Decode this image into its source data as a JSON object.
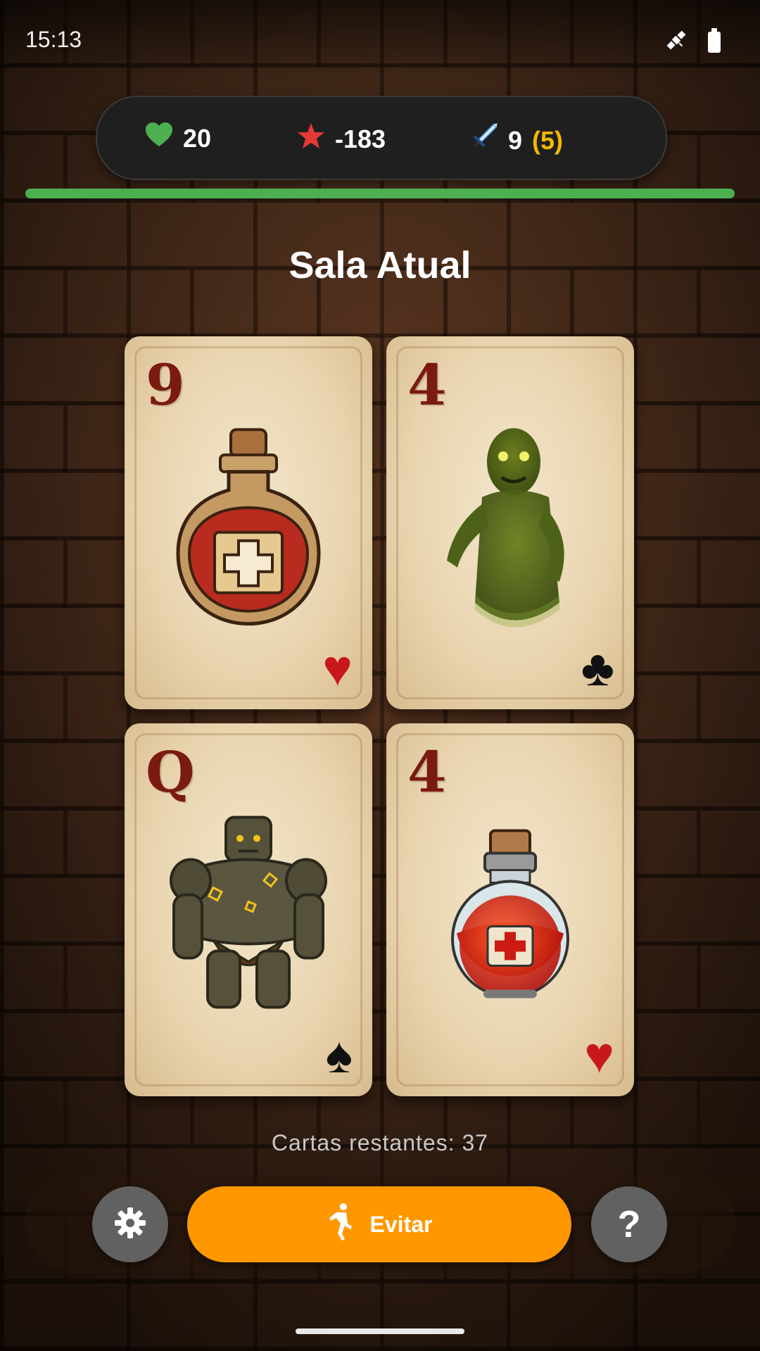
{
  "status_bar": {
    "time": "15:13",
    "icons": [
      "satellite-icon",
      "battery-icon"
    ]
  },
  "stats": {
    "health": "20",
    "score": "-183",
    "weapon_value": "9",
    "weapon_extra": "(5)",
    "icons": [
      "heart-icon",
      "star-icon",
      "sword-icon"
    ]
  },
  "health_progress": 1.0,
  "room_title": "Sala Atual",
  "cards": [
    {
      "rank": "9",
      "suit": "♥",
      "suit_color": "#c8181c",
      "art": "health-potion-round-icon"
    },
    {
      "rank": "4",
      "suit": "♣",
      "suit_color": "#111111",
      "art": "zombie-monster-icon"
    },
    {
      "rank": "Q",
      "suit": "♠",
      "suit_color": "#111111",
      "art": "stone-golem-monster-icon"
    },
    {
      "rank": "4",
      "suit": "♥",
      "suit_color": "#c8181c",
      "art": "health-potion-flask-icon"
    }
  ],
  "deck_remaining": "Cartas restantes: 37",
  "controls": {
    "avoid_label": "Evitar",
    "help_label": "?",
    "icons": [
      "gear-icon",
      "running-person-icon"
    ]
  },
  "colors": {
    "health_green": "#4caf50",
    "score_red": "#e53935",
    "weapon_extra_gold": "#f5b800",
    "avoid_orange": "#ff9800",
    "button_gray": "#616161"
  }
}
